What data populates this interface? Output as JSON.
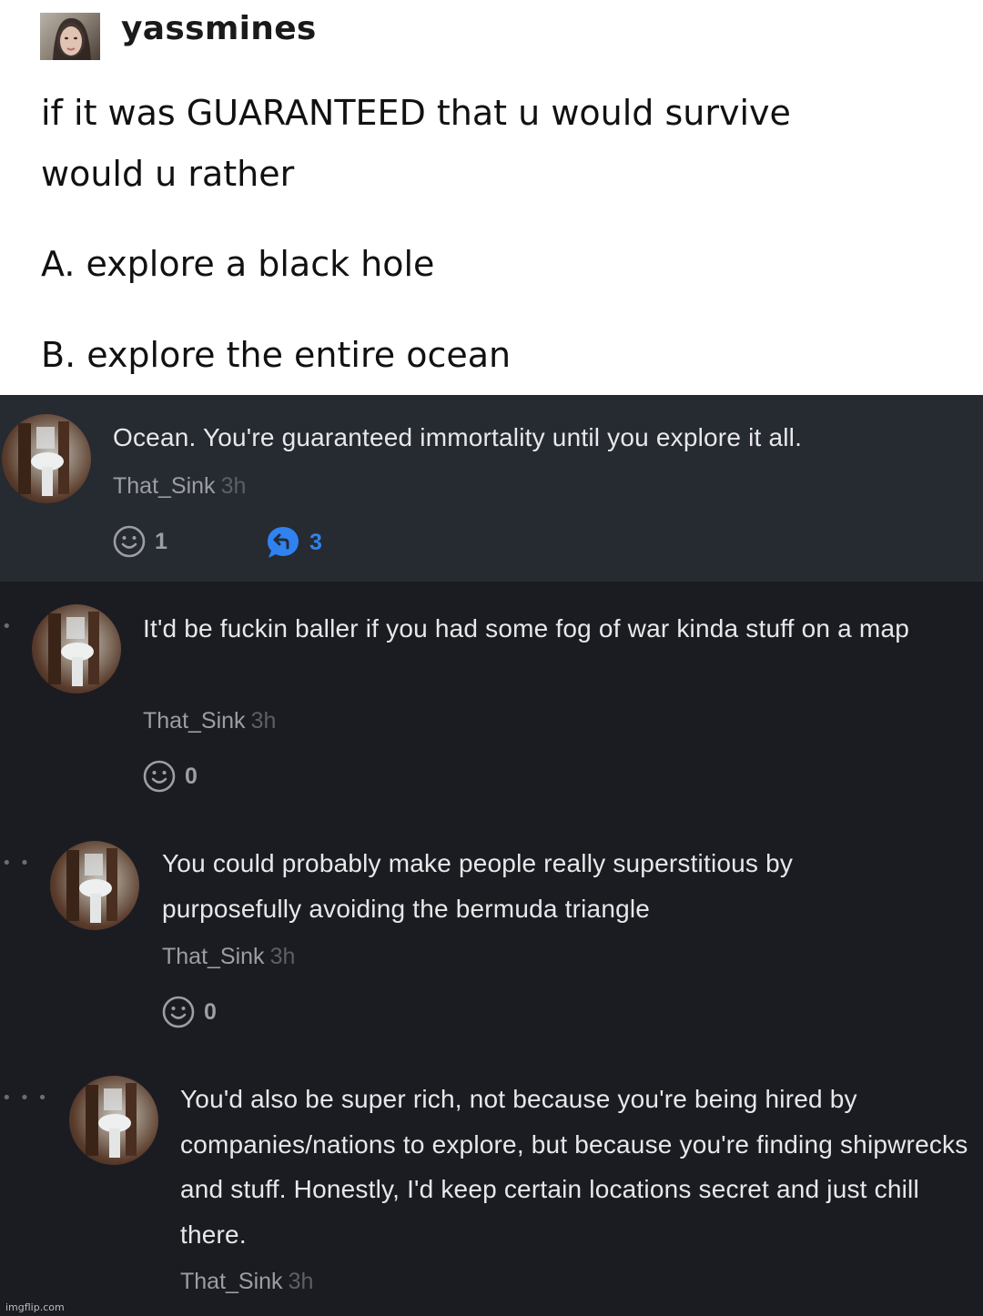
{
  "post": {
    "username": "yassmines",
    "lines": [
      "if it was GUARANTEED that u would survive",
      "would u rather",
      "A. explore a black hole",
      "B. explore the entire ocean"
    ]
  },
  "comments": [
    {
      "text": "Ocean. You're guaranteed immortality until you explore it all.",
      "author": "That_Sink",
      "time": "3h",
      "reactions": "1",
      "replies": "3"
    },
    {
      "text": "It'd be fuckin baller if you had some fog of war kinda stuff on a map",
      "author": "That_Sink",
      "time": "3h",
      "reactions": "0"
    },
    {
      "text": "You could probably make people really superstitious by purposefully avoiding the bermuda triangle",
      "author": "That_Sink",
      "time": "3h",
      "reactions": "0"
    },
    {
      "text": "You'd also be super rich, not because you're being hired by companies/nations to explore, but because you're finding shipwrecks and stuff. Honestly, I'd keep certain locations secret and just chill there.",
      "author": "That_Sink",
      "time": "3h"
    }
  ],
  "icons": {
    "reaction": "smiley-face-icon",
    "reply": "reply-bubble-icon",
    "thread_marker": "thread-dots"
  },
  "colors": {
    "reply_accent": "#2f82f0",
    "comment_bg_highlight": "#262a31",
    "comment_bg": "#1b1c21"
  },
  "watermark": "imgflip.com"
}
